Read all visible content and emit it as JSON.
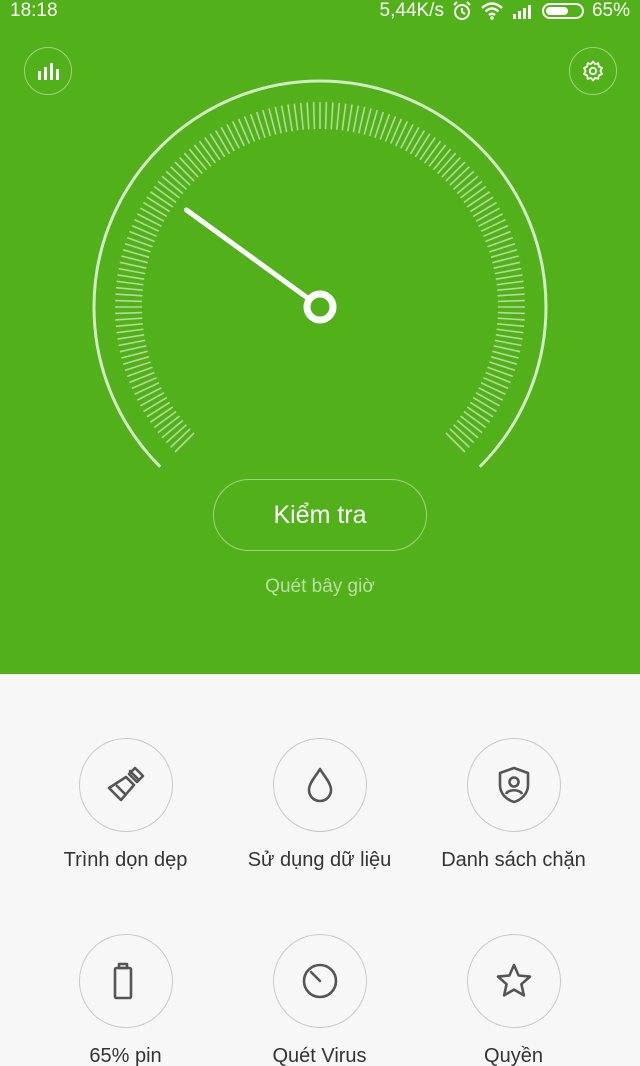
{
  "status_bar": {
    "time": "18:18",
    "network_speed": "5,44K/s",
    "battery_percent": "65%",
    "battery_level": 0.65
  },
  "header": {
    "stats_icon": "bar-chart-icon",
    "settings_icon": "gear-icon"
  },
  "gauge": {
    "needle_level": 0.3
  },
  "main": {
    "check_button_label": "Kiểm tra",
    "scan_hint": "Quét bây giờ"
  },
  "tools": [
    {
      "label": "Trình dọn dẹp",
      "icon": "broom-icon"
    },
    {
      "label": "Sử dụng dữ liệu",
      "icon": "droplet-icon"
    },
    {
      "label": "Danh sách chặn",
      "icon": "shield-user-icon"
    },
    {
      "label": "65% pin",
      "icon": "battery-icon"
    },
    {
      "label": "Quét Virus",
      "icon": "scan-dial-icon"
    },
    {
      "label": "Quyền",
      "icon": "star-icon"
    }
  ],
  "colors": {
    "brand_green": "#52b01a",
    "background": "#f7f7f7"
  }
}
